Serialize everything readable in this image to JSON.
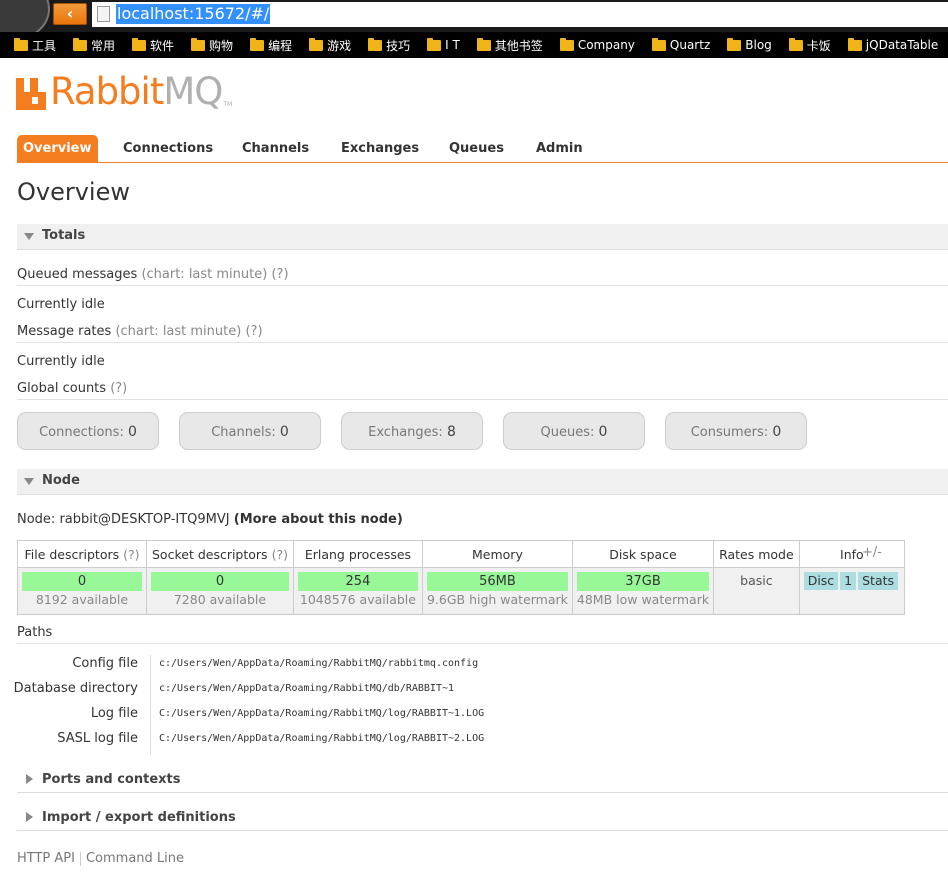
{
  "browser": {
    "url": "localhost:15672/#/",
    "bookmarks": [
      "工具",
      "常用",
      "软件",
      "购物",
      "编程",
      "游戏",
      "技巧",
      "I T",
      "其他书签",
      "Company",
      "Quartz",
      "Blog",
      "卡饭",
      "jQDataTable"
    ]
  },
  "brand": {
    "rabbit": "Rabbit",
    "mq": "MQ",
    "tm": "TM",
    "color": "#f47d20"
  },
  "tabs": [
    "Overview",
    "Connections",
    "Channels",
    "Exchanges",
    "Queues",
    "Admin"
  ],
  "page_title": "Overview",
  "totals": {
    "header": "Totals",
    "queued_label": "Queued messages",
    "queued_hint": "(chart: last minute)",
    "help": "(?)",
    "idle": "Currently idle",
    "rates_label": "Message rates",
    "rates_hint": "(chart: last minute)",
    "global_label": "Global counts",
    "counts": [
      {
        "label": "Connections:",
        "value": "0"
      },
      {
        "label": "Channels:",
        "value": "0"
      },
      {
        "label": "Exchanges:",
        "value": "8"
      },
      {
        "label": "Queues:",
        "value": "0"
      },
      {
        "label": "Consumers:",
        "value": "0"
      }
    ]
  },
  "node": {
    "header": "Node",
    "prefix": "Node:",
    "name": "rabbit@DESKTOP-ITQ9MVJ",
    "more": "(More about this node)",
    "columns": {
      "fd": "File descriptors",
      "sd": "Socket descriptors",
      "erl": "Erlang processes",
      "mem": "Memory",
      "disk": "Disk space",
      "rates": "Rates mode",
      "info": "Info",
      "help": "(?)"
    },
    "fd": {
      "value": "0",
      "sub": "8192 available"
    },
    "sd": {
      "value": "0",
      "sub": "7280 available"
    },
    "erl": {
      "value": "254",
      "sub": "1048576 available"
    },
    "mem": {
      "value": "56MB",
      "sub": "9.6GB high watermark"
    },
    "disk": {
      "value": "37GB",
      "sub": "48MB low watermark"
    },
    "rates_mode": "basic",
    "info_badges": [
      "Disc",
      "1",
      "Stats"
    ],
    "plusminus": "+/-"
  },
  "paths": {
    "header": "Paths",
    "items": [
      {
        "label": "Config file",
        "value": "c:/Users/Wen/AppData/Roaming/RabbitMQ/rabbitmq.config"
      },
      {
        "label": "Database directory",
        "value": "c:/Users/Wen/AppData/Roaming/RabbitMQ/db/RABBIT~1"
      },
      {
        "label": "Log file",
        "value": "C:/Users/Wen/AppData/Roaming/RabbitMQ/log/RABBIT~1.LOG"
      },
      {
        "label": "SASL log file",
        "value": "C:/Users/Wen/AppData/Roaming/RabbitMQ/log/RABBIT~2.LOG"
      }
    ]
  },
  "collapsed_sections": [
    "Ports and contexts",
    "Import / export definitions"
  ],
  "footer": {
    "api": "HTTP API",
    "cli": "Command Line"
  }
}
